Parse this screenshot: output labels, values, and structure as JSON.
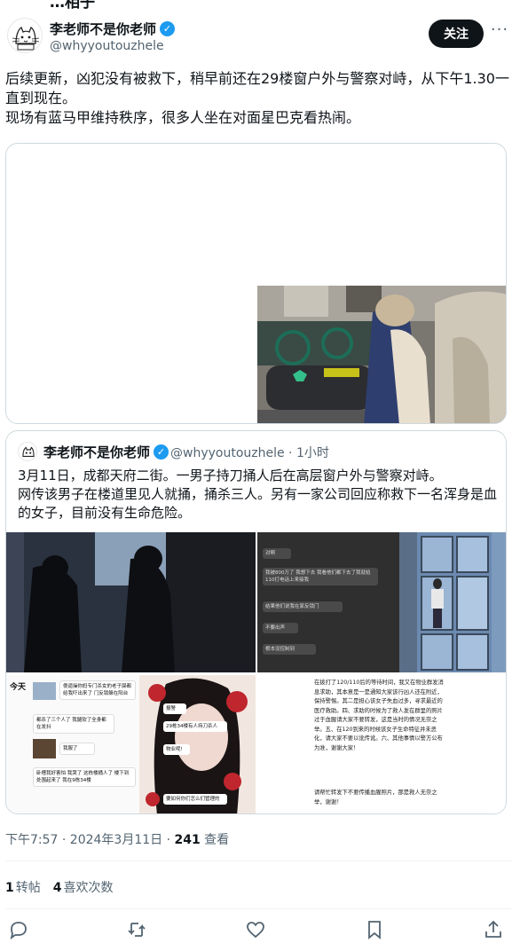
{
  "top_cut": "…相子",
  "author": {
    "name": "李老师不是你老师",
    "handle": "@whyyoutouzhele",
    "follow_label": "关注",
    "more_label": "···"
  },
  "tweet": {
    "line1": "后续更新，凶犯没有被救下，稍早前还在29楼窗户外与警察对峙，从下午1.30一直到现在。",
    "line2": "现场有蓝马甲维持秩序，很多人坐在对面星巴克看热闹。"
  },
  "quote": {
    "name": "李老师不是你老师",
    "handle": "@whyyoutouzhele · 1小时",
    "text1": "3月11日，成都天府二街。一男子持刀捅人后在高层窗户外与警察对峙。",
    "text2": "网传该男子在楼道里见人就捅，捅杀三人。另有一家公司回应称救下一名浑身是血的女子，目前没有生命危险。",
    "img3": {
      "left_top": "今天",
      "bubble1": "傻逼操你妈专门杀女的老子屎都给我吓出来了 门反锁躲在阳台",
      "bubble2": "都杀了三个人了 我腿软了全身都在发抖",
      "bubble3": "我服了",
      "bubble4": "卧槽我好害怕 我哭了 这栋楼捅人了 楼下到处围起来了 我在9栋34楼",
      "right_bubble1": "报警",
      "right_bubble2": "29栋34楼有人持刀杀人",
      "right_bubble3": "物业呢!",
      "right_bubble4": "要如何你们怎么们管理的"
    },
    "img2_msgs": [
      "对啊",
      "我被800万了 我想下去 我看他们都下去了我就给110打电话上来接我",
      "结果他们说我在家反锁门",
      "不要出声",
      "根本没控制到"
    ],
    "img4_text": "在拨打了120/110后的等待时间，我又在物业群发消息求助，其本意是一是通知大家该行凶人还在附近，保持警惕。其二是担心该女子失血过多，寻求最近的医疗救助。四、求助的时候为了救人发在群里的照片过于血腥请大家不要转发，这是当时的情况无奈之举。五、在120到来的时候该女子生命特征并未恶化，请大家不要以讹传讹。六、其他事情以警方公布为准，谢谢大家！",
    "img4_text2": "请帮忙转发下不要传播血腥照片，那是救人无奈之举，谢谢！"
  },
  "meta": {
    "time": "下午7:57 · 2024年3月11日 · ",
    "views": "241",
    "views_label": " 查看"
  },
  "stats": {
    "retweets": "1",
    "retweets_label": "转帖",
    "likes": "4",
    "likes_label": "喜欢次数"
  },
  "colors": {
    "accent": "#1d9bf0",
    "text": "#0f1419",
    "secondary": "#536471",
    "border": "#cfd9de"
  }
}
